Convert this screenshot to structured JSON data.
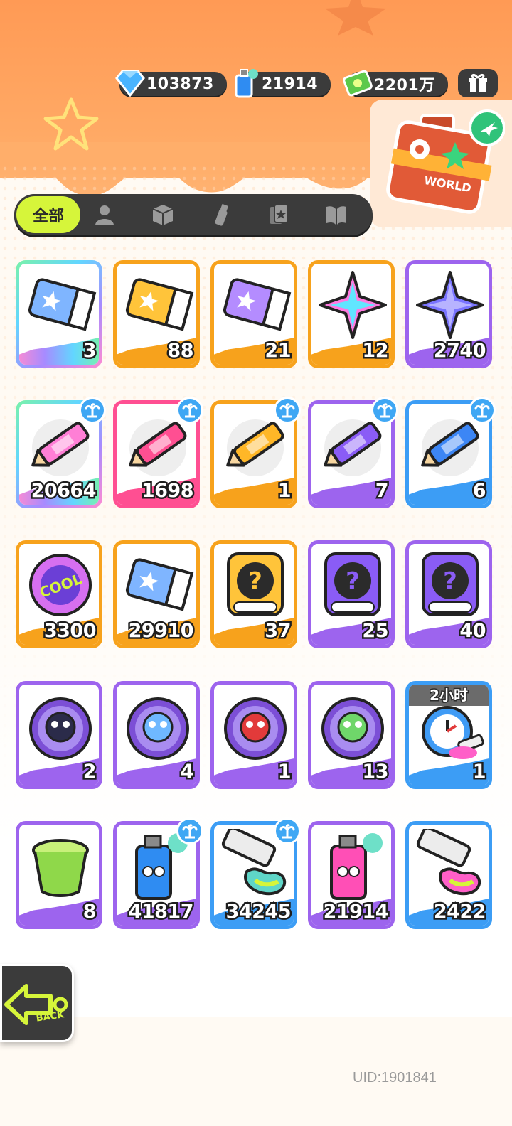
{
  "currencies": [
    {
      "icon": "diamond-icon",
      "value": "103873"
    },
    {
      "icon": "spray-can-icon",
      "value": "21914"
    },
    {
      "icon": "cash-icon",
      "value": "2201万"
    }
  ],
  "gift_icon": "gift-box-icon",
  "travel_box": {
    "icon": "world-suitcase-icon",
    "label": "WORLD"
  },
  "tabs": [
    {
      "label": "全部",
      "icon": "all-tab",
      "active": true
    },
    {
      "label": "",
      "icon": "person-icon"
    },
    {
      "label": "",
      "icon": "box-icon"
    },
    {
      "label": "",
      "icon": "spray-icon"
    },
    {
      "label": "",
      "icon": "cards-icon"
    },
    {
      "label": "",
      "icon": "book-icon"
    }
  ],
  "items": [
    {
      "name": "rainbow-deity-ticket",
      "count": "3",
      "frame": "rainbow"
    },
    {
      "name": "gold-deity-ticket",
      "count": "88",
      "frame": "orange"
    },
    {
      "name": "purple-deity-ticket",
      "count": "21",
      "frame": "orange"
    },
    {
      "name": "rainbow-star",
      "count": "12",
      "frame": "orange"
    },
    {
      "name": "purple-star",
      "count": "2740",
      "frame": "purple"
    },
    {
      "name": "rainbow-crayon",
      "count": "20664",
      "frame": "rainbow",
      "badge": true
    },
    {
      "name": "pink-crayon",
      "count": "1698",
      "frame": "pink",
      "badge": true
    },
    {
      "name": "yellow-crayon",
      "count": "1",
      "frame": "orange",
      "badge": true
    },
    {
      "name": "purple-crayon",
      "count": "7",
      "frame": "purple",
      "badge": true
    },
    {
      "name": "blue-crayon",
      "count": "6",
      "frame": "blue",
      "badge": true
    },
    {
      "name": "cool-badge",
      "count": "3300",
      "frame": "orange"
    },
    {
      "name": "season-ticket",
      "count": "29910",
      "frame": "orange"
    },
    {
      "name": "gold-deity-mystery-card",
      "count": "37",
      "frame": "orange"
    },
    {
      "name": "purple-deity-mystery-card",
      "count": "25",
      "frame": "purple"
    },
    {
      "name": "travel-mystery-card",
      "count": "40",
      "frame": "purple"
    },
    {
      "name": "cat-pet-orb",
      "count": "2",
      "frame": "purple"
    },
    {
      "name": "fish-pet-orb",
      "count": "4",
      "frame": "purple"
    },
    {
      "name": "piranha-pet-orb",
      "count": "1",
      "frame": "purple"
    },
    {
      "name": "sprout-pet-orb",
      "count": "13",
      "frame": "purple"
    },
    {
      "name": "alarm-clock",
      "count": "1",
      "frame": "blue",
      "timer": "2小时"
    },
    {
      "name": "green-jelly-cup",
      "count": "8",
      "frame": "purple"
    },
    {
      "name": "blue-spray-can",
      "count": "41817",
      "frame": "purple",
      "badge": true
    },
    {
      "name": "paint-tube-blue",
      "count": "34245",
      "frame": "blue",
      "badge": true
    },
    {
      "name": "pink-spray-can",
      "count": "21914",
      "frame": "purple"
    },
    {
      "name": "paint-tube-rainbow",
      "count": "2422",
      "frame": "blue"
    }
  ],
  "back_label": "BACK",
  "uid": "UID:1901841",
  "colors": {
    "orange": "#f7a21c",
    "purple": "#9d64ee",
    "blue": "#3c9df5",
    "pink": "#ff4f92",
    "accent": "#d6f53a",
    "dark": "#3b3b3b"
  }
}
